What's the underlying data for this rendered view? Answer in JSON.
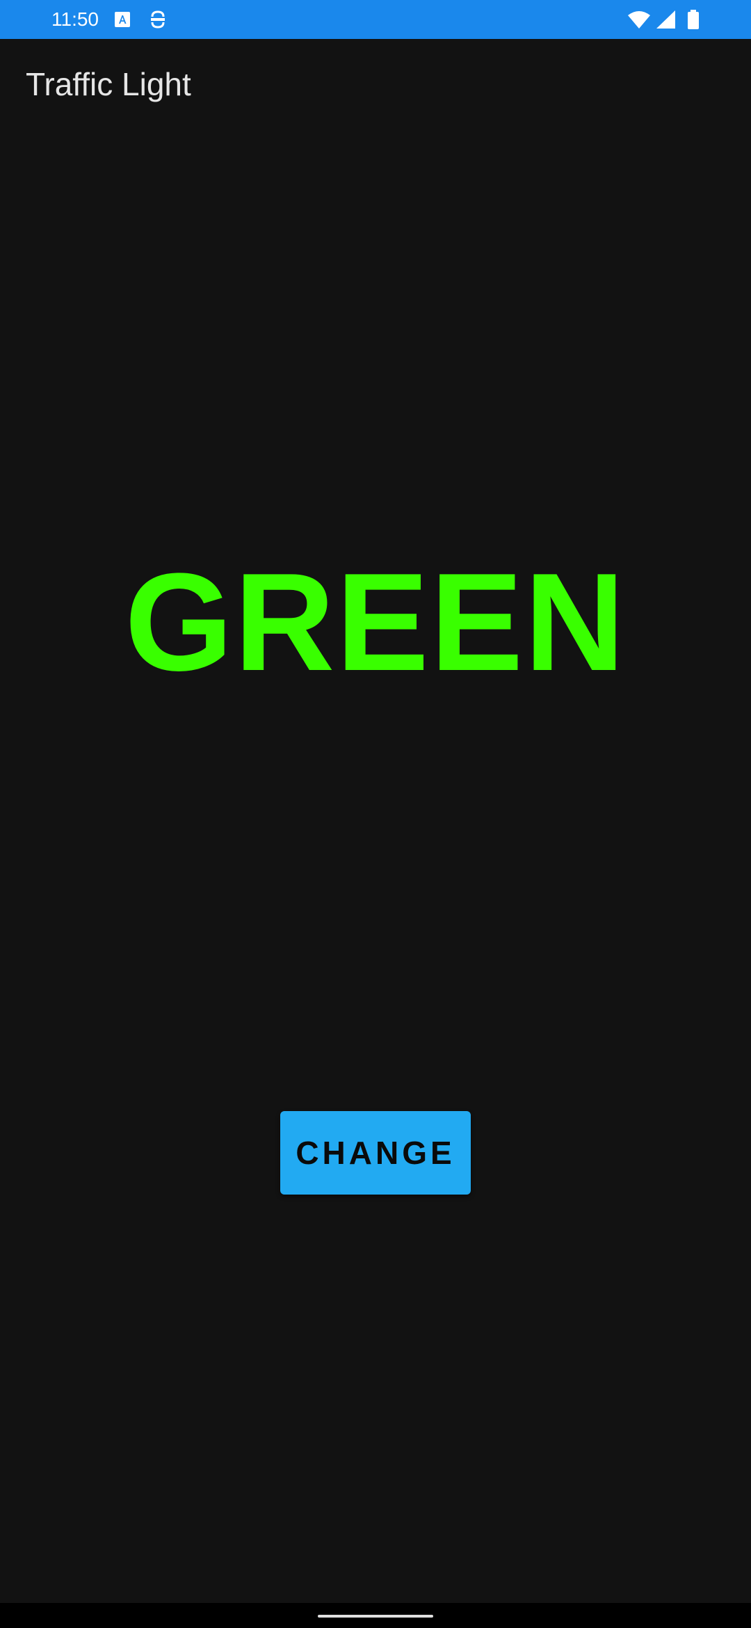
{
  "status_bar": {
    "time": "11:50",
    "background_color": "#1a88ec",
    "left_icons": [
      "translate-icon",
      "face-id-icon"
    ],
    "right_icons": [
      "wifi-icon",
      "cell-signal-icon",
      "battery-icon"
    ]
  },
  "app_bar": {
    "title": "Traffic Light"
  },
  "main": {
    "light_state": "GREEN",
    "light_color": "#39ff00",
    "change_button_label": "CHANGE",
    "button_color": "#22aaf2"
  },
  "nav_bar": {
    "handle": "gesture-handle"
  }
}
